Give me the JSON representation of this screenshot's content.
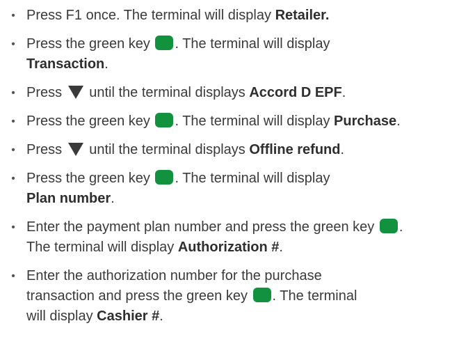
{
  "colors": {
    "green_key": "#12923f",
    "text": "#3a3a3a"
  },
  "steps": [
    {
      "bullet": "•",
      "t1": "Press F1 once. The terminal will display ",
      "b1": "Retailer."
    },
    {
      "bullet": "•",
      "t1": "Press the green key ",
      "t2": ". The terminal will display",
      "b1": "Transaction",
      "t3": "."
    },
    {
      "bullet": "•",
      "t1": "Press ",
      "t2": " until the terminal displays ",
      "b1": "Accord D EPF",
      "t3": "."
    },
    {
      "bullet": "•",
      "t1": "Press the green key ",
      "t2": ". The terminal will display ",
      "b1": "Purchase",
      "t3": "."
    },
    {
      "bullet": "•",
      "t1": "Press ",
      "t2": " until the terminal displays ",
      "b1": "Offline refund",
      "t3": "."
    },
    {
      "bullet": "•",
      "t1": "Press the green key ",
      "t2": ". The terminal will display",
      "b1": "Plan number",
      "t3": "."
    },
    {
      "bullet": "•",
      "t1": "Enter the payment plan number and press the green key ",
      "t2": ".",
      "t3": "The terminal will display ",
      "b1": "Authorization #",
      "t4": "."
    },
    {
      "bullet": "•",
      "t1": "Enter the authorization number for the purchase",
      "t2": "transaction and press the green key ",
      "t3": ". The terminal",
      "t4": "will display ",
      "b1": "Cashier #",
      "t5": "."
    }
  ]
}
